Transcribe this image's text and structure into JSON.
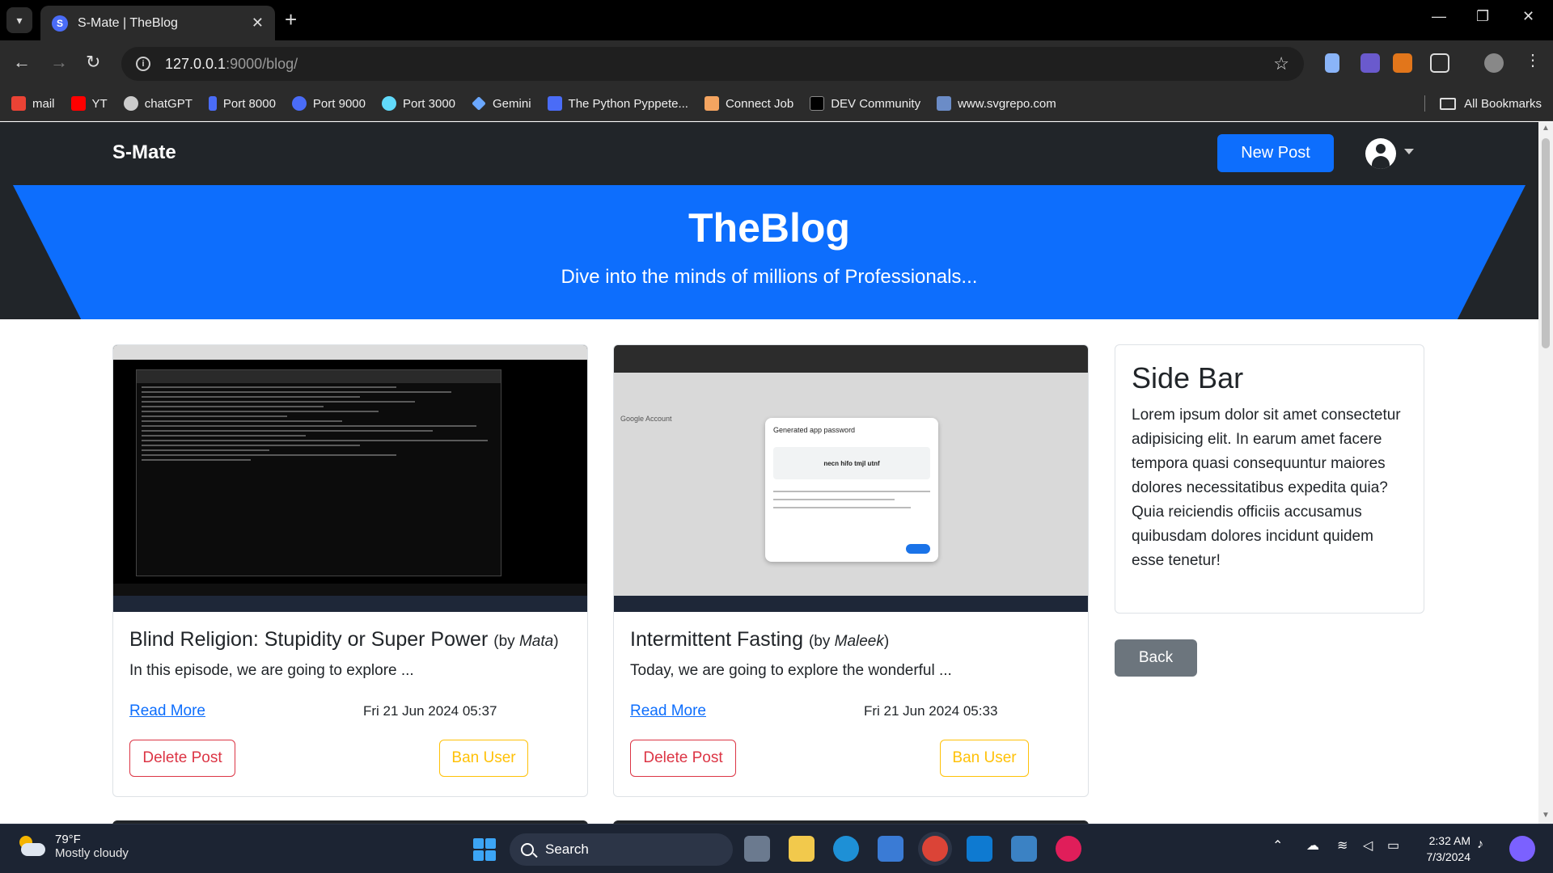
{
  "browser": {
    "tab_title": "S-Mate | TheBlog",
    "tab_favicon_letter": "S",
    "url_host": "127.0.0.1",
    "url_path": ":9000/blog/",
    "bookmarks": [
      {
        "label": "mail",
        "color": "#ea4335"
      },
      {
        "label": "YT",
        "color": "#ff0000"
      },
      {
        "label": "chatGPT",
        "color": "#cccccc"
      },
      {
        "label": "Port 8000",
        "color": "#4a6cf7"
      },
      {
        "label": "Port 9000",
        "color": "#4a6cf7"
      },
      {
        "label": "Port 3000",
        "color": "#61dafb"
      },
      {
        "label": "Gemini",
        "color": "#6aa7ff"
      },
      {
        "label": "The Python Pyppete...",
        "color": "#4a6cf7"
      },
      {
        "label": "Connect Job",
        "color": "#f4a460"
      },
      {
        "label": "DEV Community",
        "color": "#000000"
      },
      {
        "label": "www.svgrepo.com",
        "color": "#6b8cc7"
      }
    ],
    "all_bookmarks": "All Bookmarks"
  },
  "site": {
    "brand": "S-Mate",
    "new_post": "New Post",
    "hero_title": "TheBlog",
    "hero_subtitle": "Dive into the minds of millions of Professionals..."
  },
  "posts": [
    {
      "title": "Blind Religion: Stupidity or Super Power",
      "by_prefix": "(by ",
      "author": "Mata",
      "by_suffix": ")",
      "excerpt": "In this episode, we are going to explore ...",
      "read_more": "Read More",
      "date": "Fri 21 Jun 2024 05:37",
      "delete_label": "Delete Post",
      "ban_label": "Ban User"
    },
    {
      "title": "Intermittent Fasting",
      "by_prefix": "(by ",
      "author": "Maleek",
      "by_suffix": ")",
      "excerpt": "Today, we are going to explore the wonderful ...",
      "read_more": "Read More",
      "date": "Fri 21 Jun 2024 05:33",
      "delete_label": "Delete Post",
      "ban_label": "Ban User",
      "image_dialog_title": "Generated app password",
      "image_dialog_code": "necn hifo tmjl utnf",
      "image_google_account": "Google Account"
    }
  ],
  "sidebar": {
    "title": "Side Bar",
    "text": "Lorem ipsum dolor sit amet consectetur adipisicing elit. In earum amet facere tempora quasi consequuntur maiores dolores necessitatibus expedita quia? Quia reiciendis officiis accusamus quibusdam dolores incidunt quidem esse tenetur!",
    "back": "Back"
  },
  "taskbar": {
    "temp": "79°F",
    "weather": "Mostly cloudy",
    "search": "Search",
    "time": "2:32 AM",
    "date": "7/3/2024"
  },
  "colors": {
    "primary": "#0d6efd",
    "dark": "#212529",
    "danger": "#dc3545",
    "warning": "#ffc107",
    "secondary": "#6c757d"
  }
}
